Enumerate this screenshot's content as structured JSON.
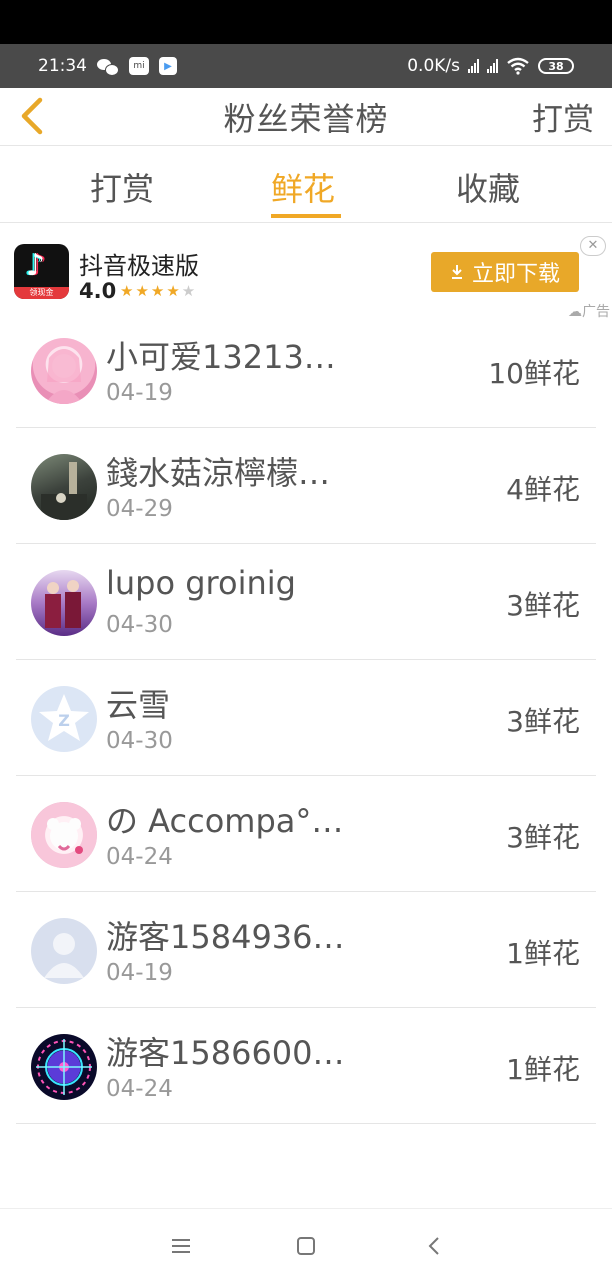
{
  "status_bar": {
    "time": "21:34",
    "network_speed": "0.0K/s",
    "battery": "38"
  },
  "header": {
    "title": "粉丝荣誉榜",
    "right_action": "打赏"
  },
  "tabs": [
    {
      "label": "打赏",
      "active": false
    },
    {
      "label": "鲜花",
      "active": true
    },
    {
      "label": "收藏",
      "active": false
    }
  ],
  "accent_color": "#f0a826",
  "ad": {
    "app_name": "抖音极速版",
    "rating": "4.0",
    "icon_badge": "领现金",
    "button_label": "立即下载",
    "ad_label": "广告"
  },
  "fans": [
    {
      "name": "小可爱13213…",
      "date": "04-19",
      "count": "10鲜花",
      "avatar": "pink-anime-girl"
    },
    {
      "name": "錢水菇涼檸檬…",
      "date": "04-29",
      "count": "4鲜花",
      "avatar": "city-street-photo"
    },
    {
      "name": "lupo groinig",
      "date": "04-30",
      "count": "3鲜花",
      "avatar": "two-people-photo"
    },
    {
      "name": "云雪",
      "date": "04-30",
      "count": "3鲜花",
      "avatar": "qq-star-default"
    },
    {
      "name": "の Accompa°…",
      "date": "04-24",
      "count": "3鲜花",
      "avatar": "teddy-bear-pink"
    },
    {
      "name": "游客1584936…",
      "date": "04-19",
      "count": "1鲜花",
      "avatar": "default-person"
    },
    {
      "name": "游客1586600…",
      "date": "04-24",
      "count": "1鲜花",
      "avatar": "neon-pattern"
    }
  ]
}
